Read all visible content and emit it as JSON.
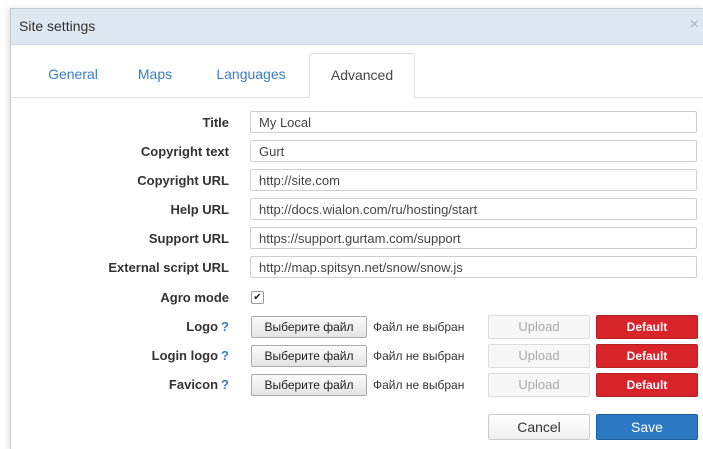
{
  "dialog": {
    "title": "Site settings",
    "close_glyph": "×"
  },
  "tabs": [
    {
      "label": "General"
    },
    {
      "label": "Maps"
    },
    {
      "label": "Languages"
    },
    {
      "label": "Advanced",
      "active": true
    }
  ],
  "fields": {
    "title": {
      "label": "Title",
      "value": "My Local"
    },
    "copyright_text": {
      "label": "Copyright text",
      "value": "Gurt"
    },
    "copyright_url": {
      "label": "Copyright URL",
      "value": "http://site.com"
    },
    "help_url": {
      "label": "Help URL",
      "value": "http://docs.wialon.com/ru/hosting/start"
    },
    "support_url": {
      "label": "Support URL",
      "value": "https://support.gurtam.com/support"
    },
    "external_script_url": {
      "label": "External script URL",
      "value": "http://map.spitsyn.net/snow/snow.js"
    }
  },
  "agro_mode": {
    "label": "Agro mode",
    "checked": true,
    "check_glyph": "✔"
  },
  "uploads": {
    "help_glyph": "?",
    "choose_label": "Выберите файл",
    "no_file_text": "Файл не выбран",
    "upload_label": "Upload",
    "default_label": "Default",
    "logo": {
      "label": "Logo"
    },
    "login_logo": {
      "label": "Login logo"
    },
    "favicon": {
      "label": "Favicon"
    }
  },
  "footer": {
    "cancel_label": "Cancel",
    "save_label": "Save"
  },
  "colors": {
    "accent_blue": "#2c78c2",
    "default_red": "#d9232b",
    "titlebar_bg": "#dde8f1",
    "link_blue": "#3a7ebf"
  }
}
